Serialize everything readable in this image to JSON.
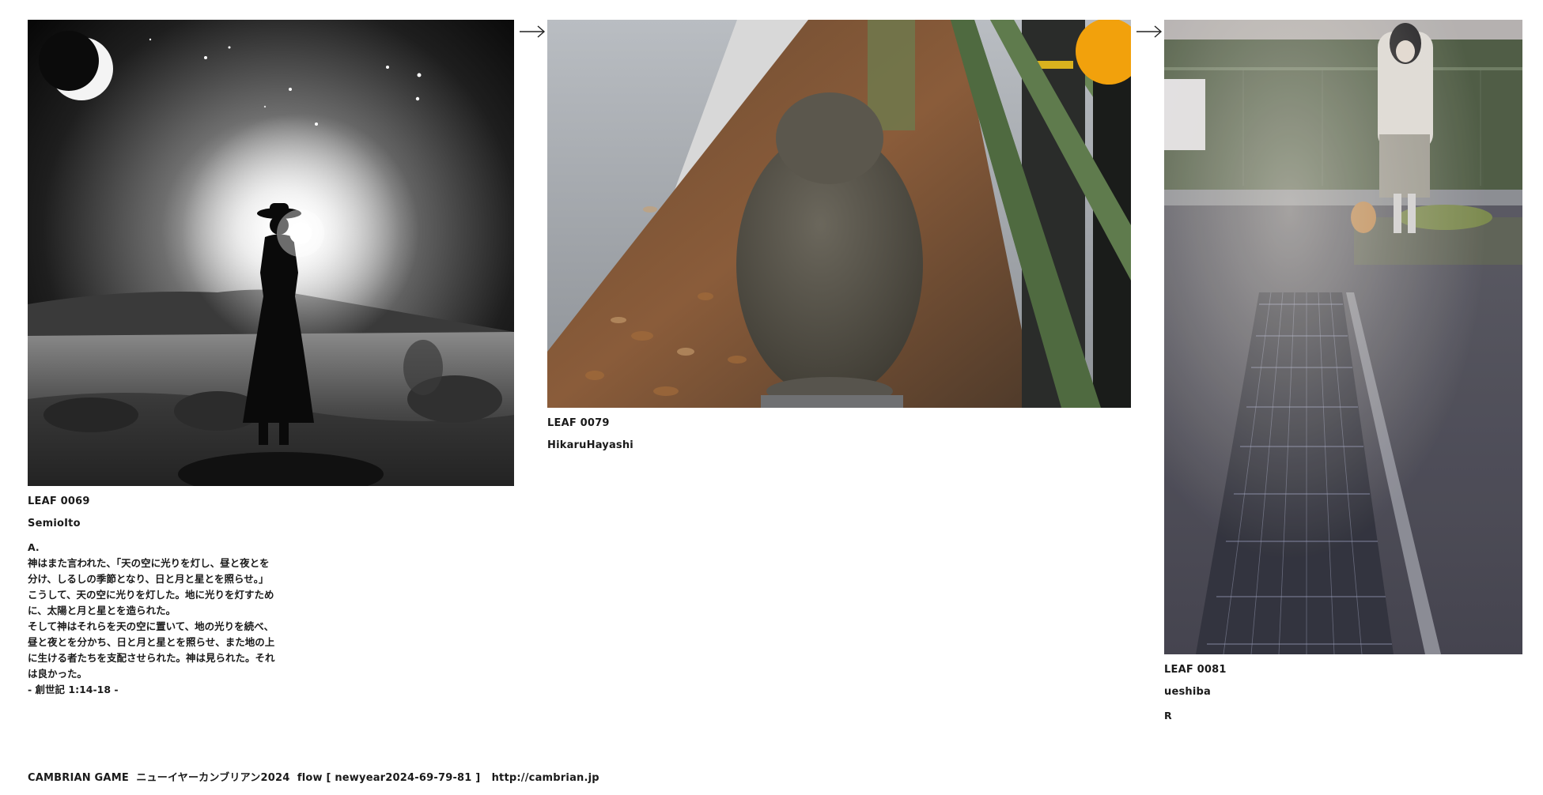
{
  "leaves": [
    {
      "id_label": "LEAF 0069",
      "author": "SemioIto",
      "text": "A.\n神はまた言われた、「天の空に光りを灯し、昼と夜とを\n分け、しるしの季節となり、日と月と星とを照らせ。」\nこうして、天の空に光りを灯した。地に光りを灯すため\nに、太陽と月と星とを造られた。\nそして神はそれらを天の空に置いて、地の光りを続べ、\n昼と夜とを分かち、日と月と星とを照らせ、また地の上\nに生ける者たちを支配させられた。神は見られた。それ\nは良かった。\n- 創世記 1:14-18 -",
      "photo_description": "moon-desert-silhouette-photo"
    },
    {
      "id_label": "LEAF 0079",
      "author": "HikaruHayashi",
      "text": "",
      "photo_description": "monkey-on-curb-photo"
    },
    {
      "id_label": "LEAF 0081",
      "author": "ueshiba",
      "text": "R",
      "photo_description": "street-grate-figure-photo"
    }
  ],
  "arrows": [
    "right-arrow-icon",
    "right-arrow-icon"
  ],
  "footer": {
    "text": "CAMBRIAN GAME  ニューイヤーカンブリアン2024  flow [ newyear2024-69-79-81 ]   ",
    "link": "http://cambrian.jp"
  }
}
